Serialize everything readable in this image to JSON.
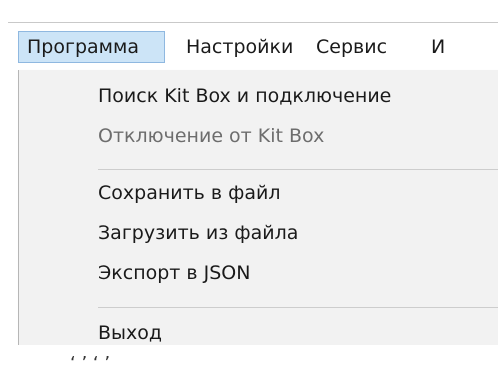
{
  "menubar": {
    "items": [
      {
        "label": "Программа"
      },
      {
        "label": "Настройки"
      },
      {
        "label": "Сервис"
      },
      {
        "label": "И"
      }
    ]
  },
  "dropdown": {
    "items": [
      {
        "label": "Поиск Kit Box и подключение",
        "enabled": true
      },
      {
        "label": "Отключение от Kit Box",
        "enabled": false
      },
      {
        "label": "Сохранить в файл",
        "enabled": true
      },
      {
        "label": "Загрузить из файла",
        "enabled": true
      },
      {
        "label": "Экспорт в JSON",
        "enabled": true
      },
      {
        "label": "Выход",
        "enabled": true
      }
    ]
  },
  "colors": {
    "active_menu_bg": "#cce4f7",
    "active_menu_border": "#8fb8e0",
    "dropdown_bg": "#f2f2f2",
    "disabled_text": "#6d6d6d"
  }
}
